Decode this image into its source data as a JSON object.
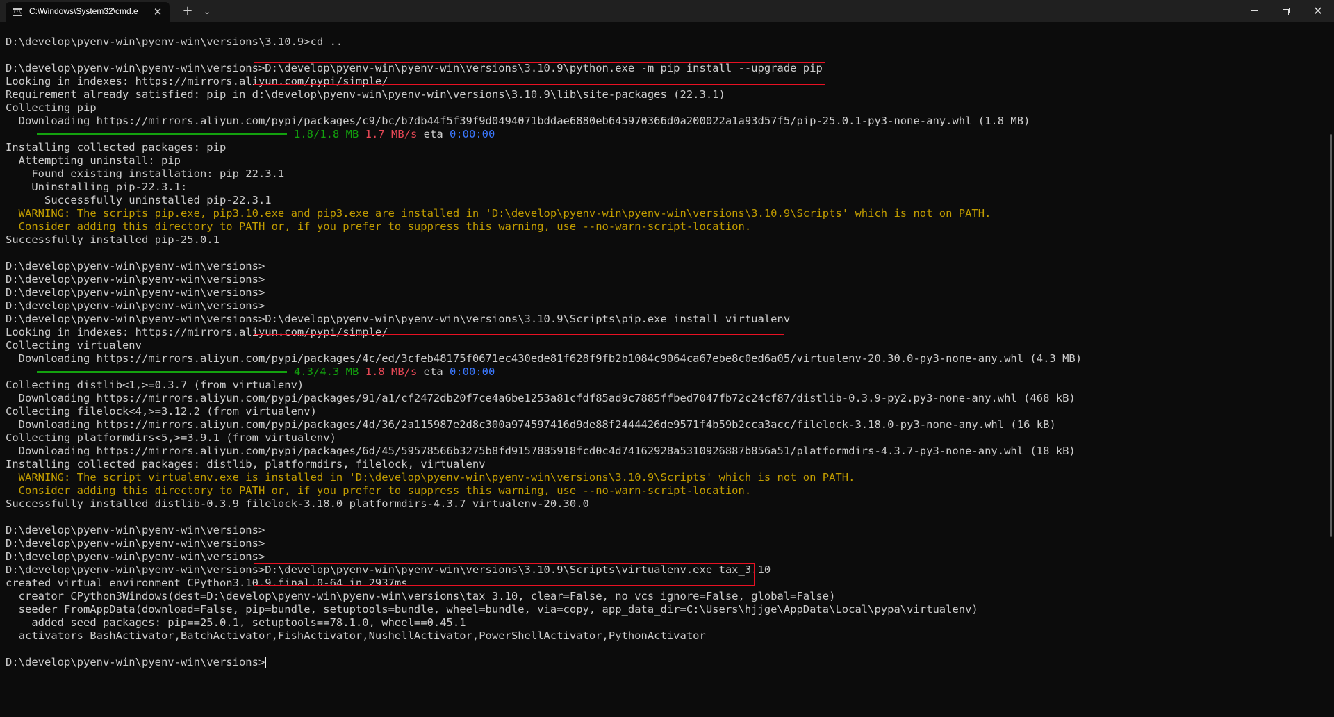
{
  "titlebar": {
    "tab_title": "C:\\Windows\\System32\\cmd.e",
    "tab_close": "✕",
    "new_tab": "+",
    "dropdown": "⌄",
    "close_glyph": "✕"
  },
  "colors": {
    "background": "#0c0c0c",
    "text": "#cccccc",
    "warning": "#c19c00",
    "progress": "#13a10e",
    "speed": "#e74856",
    "eta": "#3b78ff",
    "highlight_box": "#e81123"
  },
  "terminal": {
    "lines": [
      "D:\\develop\\pyenv-win\\pyenv-win\\versions\\3.10.9>cd ..",
      "",
      "D:\\develop\\pyenv-win\\pyenv-win\\versions>D:\\develop\\pyenv-win\\pyenv-win\\versions\\3.10.9\\python.exe -m pip install --upgrade pip",
      "Looking in indexes: https://mirrors.aliyun.com/pypi/simple/",
      "Requirement already satisfied: pip in d:\\develop\\pyenv-win\\pyenv-win\\versions\\3.10.9\\lib\\site-packages (22.3.1)",
      "Collecting pip",
      "  Downloading https://mirrors.aliyun.com/pypi/packages/c9/bc/b7db44f5f39f9d0494071bddae6880eb645970366d0a200022a1a93d57f5/pip-25.0.1-py3-none-any.whl (1.8 MB)"
    ],
    "progress1": {
      "size": "1.8/1.8 MB",
      "speed": "1.7 MB/s",
      "eta_label": "eta",
      "eta": "0:00:00",
      "fraction": 1.0
    },
    "lines2": [
      "Installing collected packages: pip",
      "  Attempting uninstall: pip",
      "    Found existing installation: pip 22.3.1",
      "    Uninstalling pip-22.3.1:",
      "      Successfully uninstalled pip-22.3.1"
    ],
    "warning1": [
      "  WARNING: The scripts pip.exe, pip3.10.exe and pip3.exe are installed in 'D:\\develop\\pyenv-win\\pyenv-win\\versions\\3.10.9\\Scripts' which is not on PATH.",
      "  Consider adding this directory to PATH or, if you prefer to suppress this warning, use --no-warn-script-location."
    ],
    "lines3": [
      "Successfully installed pip-25.0.1",
      "",
      "D:\\develop\\pyenv-win\\pyenv-win\\versions>",
      "D:\\develop\\pyenv-win\\pyenv-win\\versions>",
      "D:\\develop\\pyenv-win\\pyenv-win\\versions>",
      "D:\\develop\\pyenv-win\\pyenv-win\\versions>",
      "D:\\develop\\pyenv-win\\pyenv-win\\versions>D:\\develop\\pyenv-win\\pyenv-win\\versions\\3.10.9\\Scripts\\pip.exe install virtualenv",
      "Looking in indexes: https://mirrors.aliyun.com/pypi/simple/",
      "Collecting virtualenv",
      "  Downloading https://mirrors.aliyun.com/pypi/packages/4c/ed/3cfeb48175f0671ec430ede81f628f9fb2b1084c9064ca67ebe8c0ed6a05/virtualenv-20.30.0-py3-none-any.whl (4.3 MB)"
    ],
    "progress2": {
      "size": "4.3/4.3 MB",
      "speed": "1.8 MB/s",
      "eta_label": "eta",
      "eta": "0:00:00",
      "fraction": 1.0
    },
    "lines4": [
      "Collecting distlib<1,>=0.3.7 (from virtualenv)",
      "  Downloading https://mirrors.aliyun.com/pypi/packages/91/a1/cf2472db20f7ce4a6be1253a81cfdf85ad9c7885ffbed7047fb72c24cf87/distlib-0.3.9-py2.py3-none-any.whl (468 kB)",
      "Collecting filelock<4,>=3.12.2 (from virtualenv)",
      "  Downloading https://mirrors.aliyun.com/pypi/packages/4d/36/2a115987e2d8c300a974597416d9de88f2444426de9571f4b59b2cca3acc/filelock-3.18.0-py3-none-any.whl (16 kB)",
      "Collecting platformdirs<5,>=3.9.1 (from virtualenv)",
      "  Downloading https://mirrors.aliyun.com/pypi/packages/6d/45/59578566b3275b8fd9157885918fcd0c4d74162928a5310926887b856a51/platformdirs-4.3.7-py3-none-any.whl (18 kB)",
      "Installing collected packages: distlib, platformdirs, filelock, virtualenv"
    ],
    "warning2": [
      "  WARNING: The script virtualenv.exe is installed in 'D:\\develop\\pyenv-win\\pyenv-win\\versions\\3.10.9\\Scripts' which is not on PATH.",
      "  Consider adding this directory to PATH or, if you prefer to suppress this warning, use --no-warn-script-location."
    ],
    "lines5": [
      "Successfully installed distlib-0.3.9 filelock-3.18.0 platformdirs-4.3.7 virtualenv-20.30.0",
      "",
      "D:\\develop\\pyenv-win\\pyenv-win\\versions>",
      "D:\\develop\\pyenv-win\\pyenv-win\\versions>",
      "D:\\develop\\pyenv-win\\pyenv-win\\versions>",
      "D:\\develop\\pyenv-win\\pyenv-win\\versions>D:\\develop\\pyenv-win\\pyenv-win\\versions\\3.10.9\\Scripts\\virtualenv.exe tax_3.10",
      "created virtual environment CPython3.10.9.final.0-64 in 2937ms",
      "  creator CPython3Windows(dest=D:\\develop\\pyenv-win\\pyenv-win\\versions\\tax_3.10, clear=False, no_vcs_ignore=False, global=False)",
      "  seeder FromAppData(download=False, pip=bundle, setuptools=bundle, wheel=bundle, via=copy, app_data_dir=C:\\Users\\hjjge\\AppData\\Local\\pypa\\virtualenv)",
      "    added seed packages: pip==25.0.1, setuptools==78.1.0, wheel==0.45.1",
      "  activators BashActivator,BatchActivator,FishActivator,NushellActivator,PowerShellActivator,PythonActivator",
      ""
    ],
    "prompt": "D:\\develop\\pyenv-win\\pyenv-win\\versions>"
  }
}
